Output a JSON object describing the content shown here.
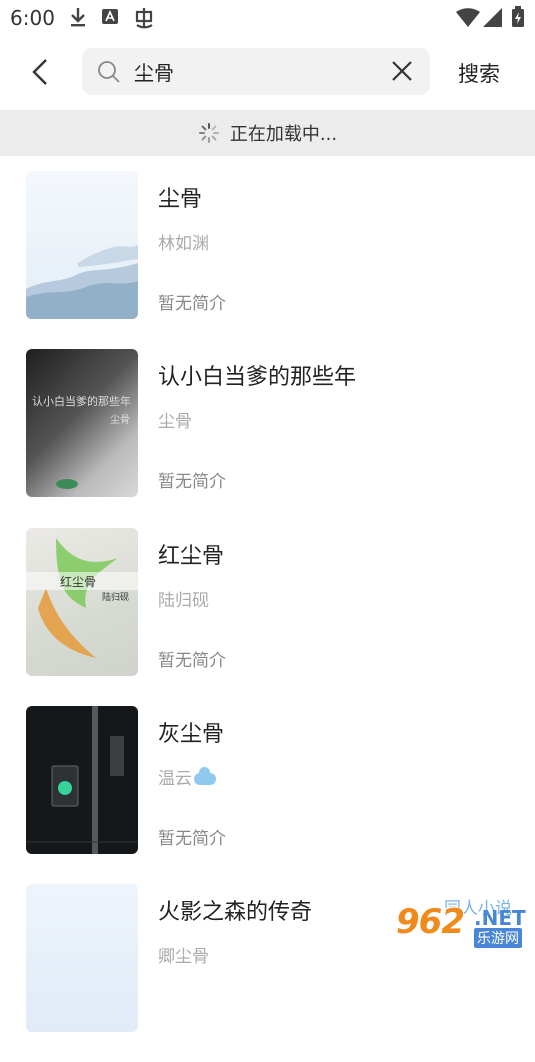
{
  "status_bar": {
    "time": "6:00"
  },
  "search": {
    "query": "尘骨",
    "button_label": "搜索"
  },
  "loading": {
    "text": "正在加载中..."
  },
  "books": [
    {
      "title": "尘骨",
      "author": "林如渊",
      "desc": "暂无简介",
      "cover": {
        "bg": "#eaf1f8",
        "overlay_text": "",
        "overlay_sub": ""
      }
    },
    {
      "title": "认小白当爹的那些年",
      "author": "尘骨",
      "desc": "暂无简介",
      "cover": {
        "bg": "#3a3a3a",
        "overlay_text": "认小白当爹的那些年",
        "overlay_sub": "尘骨"
      }
    },
    {
      "title": "红尘骨",
      "author": "陆归砚",
      "desc": "暂无简介",
      "cover": {
        "bg": "#e9e4dc",
        "overlay_text": "红尘骨",
        "overlay_sub": "陆归砚"
      }
    },
    {
      "title": "灰尘骨",
      "author": "温云",
      "desc": "暂无简介",
      "cover": {
        "bg": "#15181a",
        "overlay_text": "",
        "overlay_sub": ""
      }
    },
    {
      "title": "火影之森的传奇",
      "author": "卿尘骨",
      "desc": "",
      "cover": {
        "bg": "#e3eef9",
        "overlay_text": "",
        "overlay_sub": ""
      }
    }
  ],
  "watermark": {
    "tag": "同人小说",
    "logo": "962",
    "net": ".NET",
    "site": "乐游网"
  },
  "colors": {
    "search_bg": "#f2f2f2",
    "loading_bg": "#ececec",
    "watermark_orange": "#f08a1c",
    "watermark_blue": "#4a86d8"
  }
}
